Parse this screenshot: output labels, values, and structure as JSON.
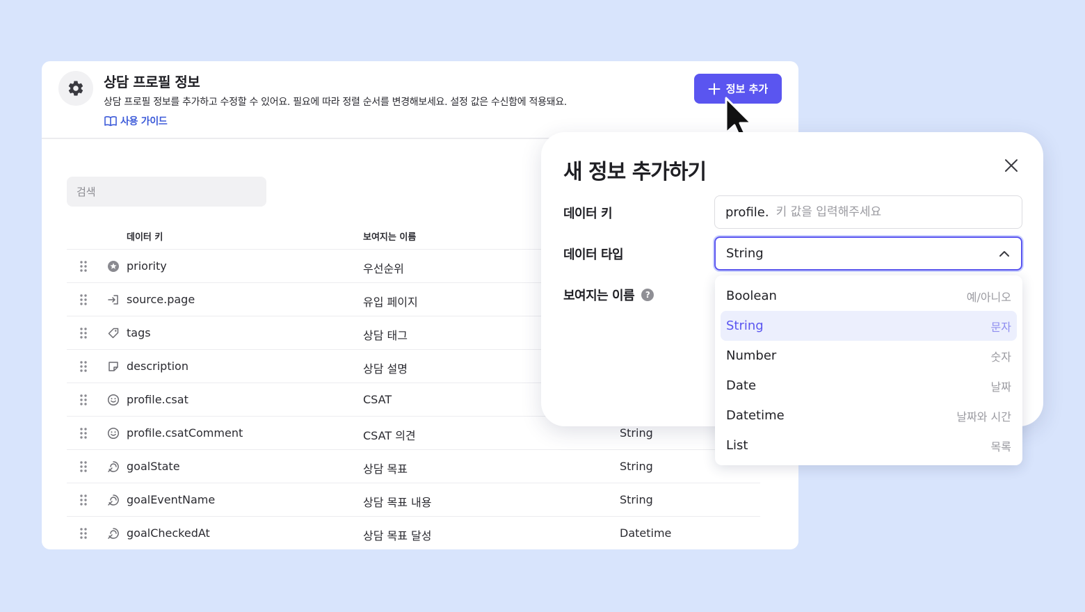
{
  "header": {
    "title": "상담 프로필 정보",
    "description": "상담 프로필 정보를 추가하고 수정할 수 있어요. 필요에 따라 정렬 순서를 변경해보세요. 설정 값은 수신함에 적용돼요.",
    "guide_link": "사용 가이드",
    "add_button": "정보 추가"
  },
  "search": {
    "placeholder": "검색"
  },
  "table": {
    "columns": [
      "데이터 키",
      "보여지는 이름"
    ],
    "rows": [
      {
        "icon": "star-badge-icon",
        "key": "priority",
        "display": "우선순위",
        "type": ""
      },
      {
        "icon": "enter-icon",
        "key": "source.page",
        "display": "유입 페이지",
        "type": ""
      },
      {
        "icon": "tag-icon",
        "key": "tags",
        "display": "상담 태그",
        "type": ""
      },
      {
        "icon": "note-icon",
        "key": "description",
        "display": "상담 설명",
        "type": ""
      },
      {
        "icon": "smile-icon",
        "key": "profile.csat",
        "display": "CSAT",
        "type": ""
      },
      {
        "icon": "smile-icon",
        "key": "profile.csatComment",
        "display": "CSAT 의견",
        "type": "String"
      },
      {
        "icon": "goal-icon",
        "key": "goalState",
        "display": "상담 목표",
        "type": "String"
      },
      {
        "icon": "goal-icon",
        "key": "goalEventName",
        "display": "상담 목표 내용",
        "type": "String"
      },
      {
        "icon": "goal-icon",
        "key": "goalCheckedAt",
        "display": "상담 목표 달성",
        "type": "Datetime"
      }
    ]
  },
  "modal": {
    "title": "새 정보 추가하기",
    "key_label": "데이터 키",
    "key_prefix": "profile.",
    "key_placeholder": "키 값을 입력해주세요",
    "type_label": "데이터 타입",
    "type_value": "String",
    "name_label": "보여지는 이름",
    "help_glyph": "?"
  },
  "dropdown": {
    "options": [
      {
        "label": "Boolean",
        "hint": "예/아니오"
      },
      {
        "label": "String",
        "hint": "문자"
      },
      {
        "label": "Number",
        "hint": "숫자"
      },
      {
        "label": "Date",
        "hint": "날짜"
      },
      {
        "label": "Datetime",
        "hint": "날짜와 시간"
      },
      {
        "label": "List",
        "hint": "목록"
      }
    ],
    "selected": "String"
  },
  "colors": {
    "accent": "#5a55f0",
    "background": "#d8e4fc",
    "link": "#3d5bd9"
  }
}
